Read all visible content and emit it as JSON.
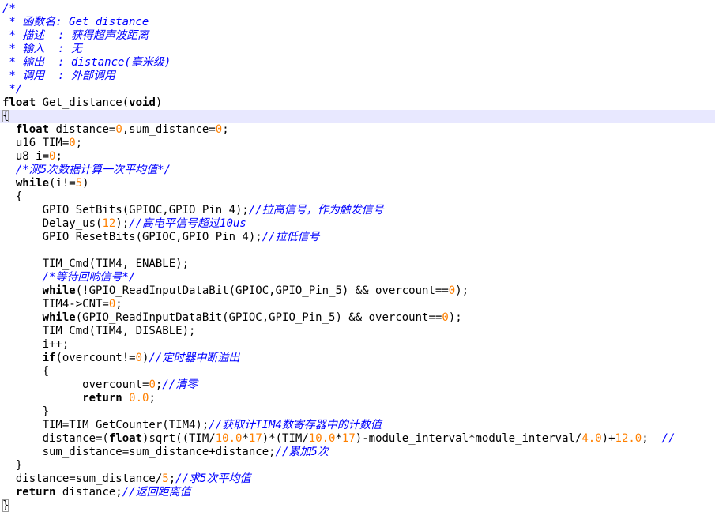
{
  "editor": {
    "lines": [
      [
        [
          "cm",
          "/*"
        ]
      ],
      [
        [
          "cm",
          " * 函数名: Get_distance"
        ]
      ],
      [
        [
          "cm",
          " * 描述  : 获得超声波距离"
        ]
      ],
      [
        [
          "cm",
          " * 输入  : 无"
        ]
      ],
      [
        [
          "cm",
          " * 输出  : distance(毫米级)"
        ]
      ],
      [
        [
          "cm",
          " * 调用  : 外部调用"
        ]
      ],
      [
        [
          "cm",
          " */"
        ]
      ],
      [
        [
          "kw",
          "float"
        ],
        [
          "t",
          " Get_distance("
        ],
        [
          "kw",
          "void"
        ],
        [
          "t",
          ")"
        ]
      ],
      [
        [
          "bx",
          "{"
        ]
      ],
      [
        [
          "t",
          "  "
        ],
        [
          "kw",
          "float"
        ],
        [
          "t",
          " distance="
        ],
        [
          "num",
          "0"
        ],
        [
          "t",
          ",sum_distance="
        ],
        [
          "num",
          "0"
        ],
        [
          "t",
          ";"
        ]
      ],
      [
        [
          "t",
          "  u16 TIM="
        ],
        [
          "num",
          "0"
        ],
        [
          "t",
          ";"
        ]
      ],
      [
        [
          "t",
          "  u8 i="
        ],
        [
          "num",
          "0"
        ],
        [
          "t",
          ";"
        ]
      ],
      [
        [
          "t",
          "  "
        ],
        [
          "cm",
          "/*测5次数据计算一次平均值*/"
        ]
      ],
      [
        [
          "t",
          "  "
        ],
        [
          "kw",
          "while"
        ],
        [
          "t",
          "(i!="
        ],
        [
          "num",
          "5"
        ],
        [
          "t",
          ")"
        ]
      ],
      [
        [
          "t",
          "  {"
        ]
      ],
      [
        [
          "t",
          "      GPIO_SetBits(GPIOC,GPIO_Pin_4);"
        ],
        [
          "cm",
          "//拉高信号，作为触发信号"
        ]
      ],
      [
        [
          "t",
          "      Delay_us("
        ],
        [
          "num",
          "12"
        ],
        [
          "t",
          ");"
        ],
        [
          "cm",
          "//高电平信号超过10us"
        ]
      ],
      [
        [
          "t",
          "      GPIO_ResetBits(GPIOC,GPIO_Pin_4);"
        ],
        [
          "cm",
          "//拉低信号"
        ]
      ],
      [
        [
          "t",
          ""
        ]
      ],
      [
        [
          "t",
          "      TIM_Cmd(TIM4, ENABLE);"
        ]
      ],
      [
        [
          "t",
          "      "
        ],
        [
          "cm",
          "/*等待回响信号*/"
        ]
      ],
      [
        [
          "t",
          "      "
        ],
        [
          "kw",
          "while"
        ],
        [
          "t",
          "(!GPIO_ReadInputDataBit(GPIOC,GPIO_Pin_5) && overcount=="
        ],
        [
          "num",
          "0"
        ],
        [
          "t",
          ");"
        ]
      ],
      [
        [
          "t",
          "      TIM4->CNT="
        ],
        [
          "num",
          "0"
        ],
        [
          "t",
          ";"
        ]
      ],
      [
        [
          "t",
          "      "
        ],
        [
          "kw",
          "while"
        ],
        [
          "t",
          "(GPIO_ReadInputDataBit(GPIOC,GPIO_Pin_5) && overcount=="
        ],
        [
          "num",
          "0"
        ],
        [
          "t",
          ");"
        ]
      ],
      [
        [
          "t",
          "      TIM_Cmd(TIM4, DISABLE);"
        ]
      ],
      [
        [
          "t",
          "      i++;"
        ]
      ],
      [
        [
          "t",
          "      "
        ],
        [
          "kw",
          "if"
        ],
        [
          "t",
          "(overcount!="
        ],
        [
          "num",
          "0"
        ],
        [
          "t",
          ")"
        ],
        [
          "cm",
          "//定时器中断溢出"
        ]
      ],
      [
        [
          "t",
          "      {"
        ]
      ],
      [
        [
          "t",
          "            overcount="
        ],
        [
          "num",
          "0"
        ],
        [
          "t",
          ";"
        ],
        [
          "cm",
          "//清零"
        ]
      ],
      [
        [
          "t",
          "            "
        ],
        [
          "kw",
          "return"
        ],
        [
          "t",
          " "
        ],
        [
          "num",
          "0.0"
        ],
        [
          "t",
          ";"
        ]
      ],
      [
        [
          "t",
          "      }"
        ]
      ],
      [
        [
          "t",
          "      TIM=TIM_GetCounter(TIM4);"
        ],
        [
          "cm",
          "//获取计TIM4数寄存器中的计数值"
        ]
      ],
      [
        [
          "t",
          "      distance=("
        ],
        [
          "kw",
          "float"
        ],
        [
          "t",
          ")sqrt((TIM/"
        ],
        [
          "num",
          "10.0"
        ],
        [
          "t",
          "*"
        ],
        [
          "num",
          "17"
        ],
        [
          "t",
          ")*(TIM/"
        ],
        [
          "num",
          "10.0"
        ],
        [
          "t",
          "*"
        ],
        [
          "num",
          "17"
        ],
        [
          "t",
          ")-module_interval*module_interval/"
        ],
        [
          "num",
          "4.0"
        ],
        [
          "t",
          ")+"
        ],
        [
          "num",
          "12.0"
        ],
        [
          "t",
          ";  "
        ],
        [
          "cm",
          "//"
        ]
      ],
      [
        [
          "t",
          "      sum_distance=sum_distance+distance;"
        ],
        [
          "cm",
          "//累加5次"
        ]
      ],
      [
        [
          "t",
          "  }"
        ]
      ],
      [
        [
          "t",
          "  distance=sum_distance/"
        ],
        [
          "num",
          "5"
        ],
        [
          "t",
          ";"
        ],
        [
          "cm",
          "//求5次平均值"
        ]
      ],
      [
        [
          "t",
          "  "
        ],
        [
          "kw",
          "return"
        ],
        [
          "t",
          " distance;"
        ],
        [
          "cm",
          "//返回距离值"
        ]
      ],
      [
        [
          "bx",
          "}"
        ]
      ]
    ],
    "caret_line": 8,
    "colors": {
      "keyword": "#000000",
      "number": "#ff8000",
      "comment": "#0000ff",
      "text": "#000000",
      "caret_line_bg": "#e8e8ff"
    }
  }
}
